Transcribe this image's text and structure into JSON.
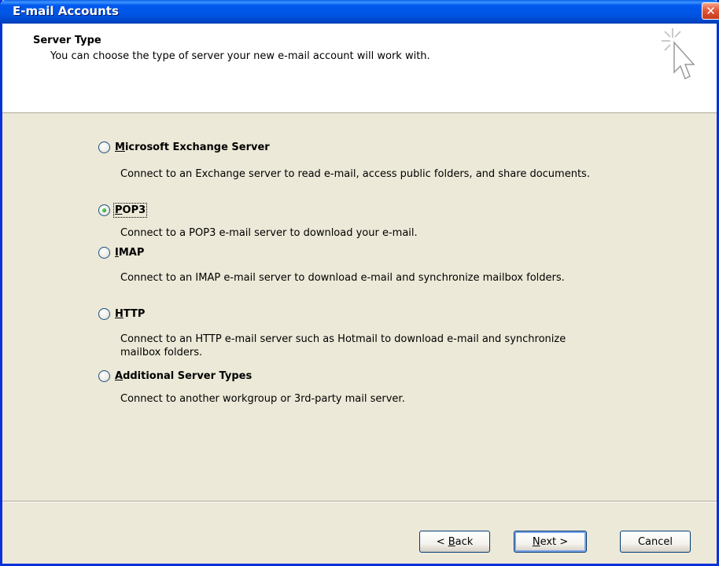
{
  "window": {
    "title": "E-mail Accounts",
    "close_glyph": "✕"
  },
  "header": {
    "title": "Server Type",
    "subtitle": "You can choose the type of server your new e-mail account will work with.",
    "icon": "wizard-cursor-sparkle-icon"
  },
  "options": [
    {
      "label": "Microsoft Exchange Server",
      "mnemonic": "M",
      "rest": "icrosoft Exchange Server",
      "description": "Connect to an Exchange server to read e-mail, access public folders, and share documents.",
      "selected": false
    },
    {
      "label": "POP3",
      "mnemonic": "P",
      "rest": "OP3",
      "description": "Connect to a POP3 e-mail server to download your e-mail.",
      "selected": true
    },
    {
      "label": "IMAP",
      "mnemonic": "I",
      "rest": "MAP",
      "description": "Connect to an IMAP e-mail server to download e-mail and synchronize mailbox folders.",
      "selected": false
    },
    {
      "label": "HTTP",
      "mnemonic": "H",
      "rest": "TTP",
      "description": "Connect to an HTTP e-mail server such as Hotmail to download e-mail and synchronize mailbox folders.",
      "selected": false
    },
    {
      "label": "Additional Server Types",
      "mnemonic": "A",
      "rest": "dditional Server Types",
      "description": "Connect to another workgroup or 3rd-party mail server.",
      "selected": false
    }
  ],
  "buttons": {
    "back": {
      "prefix": "< ",
      "mnemonic": "B",
      "rest": "ack"
    },
    "next": {
      "mnemonic": "N",
      "rest": "ext >"
    },
    "cancel": {
      "label": "Cancel"
    }
  },
  "colors": {
    "titlebar": "#0058EE",
    "dialog_bg": "#ECE9D8",
    "radio_selected": "#21A121"
  }
}
